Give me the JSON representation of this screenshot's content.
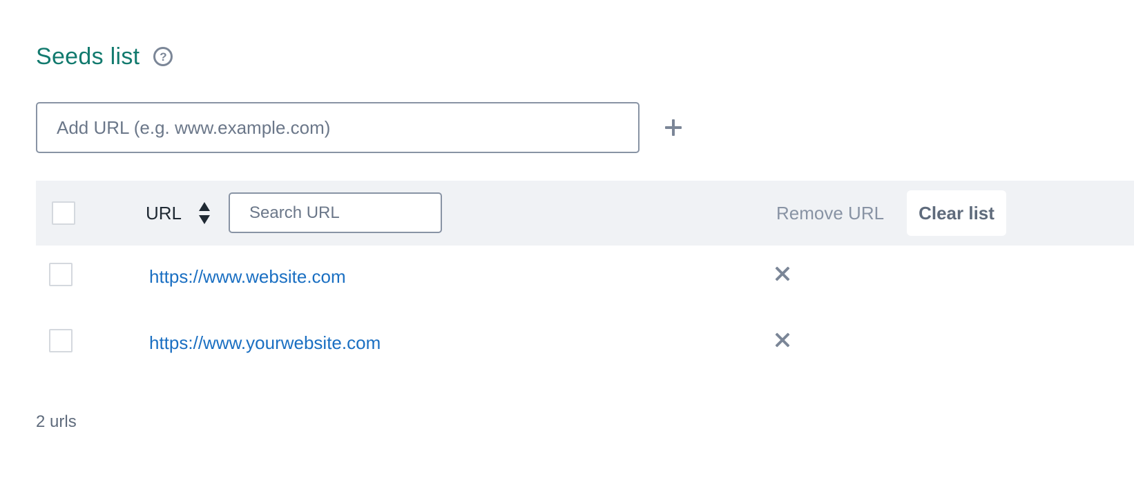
{
  "header": {
    "title": "Seeds list",
    "help_icon": "question-circle"
  },
  "add_url": {
    "placeholder": "Add URL (e.g. www.example.com)",
    "value": "",
    "add_icon": "plus"
  },
  "table": {
    "column_label": "URL",
    "sort_icon": "sort-updown",
    "search_placeholder": "Search URL",
    "remove_label": "Remove URL",
    "clear_label": "Clear list",
    "rows": [
      {
        "url": "https://www.website.com",
        "checked": false,
        "remove_icon": "close"
      },
      {
        "url": "https://www.yourwebsite.com",
        "checked": false,
        "remove_icon": "close"
      }
    ]
  },
  "footer": {
    "count_text": "2 urls"
  },
  "colors": {
    "title": "#127a6e",
    "link": "#1a6fc2",
    "header_bg": "#f0f2f5",
    "muted": "#8893a4"
  }
}
